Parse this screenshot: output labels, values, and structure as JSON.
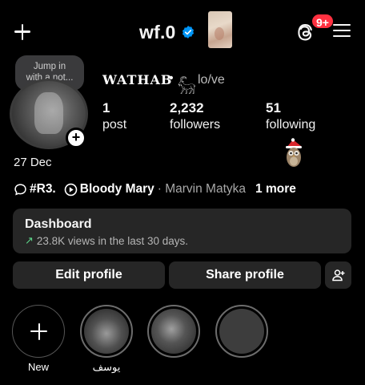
{
  "header": {
    "username": "wf.0",
    "badge_count": "9+",
    "icons": [
      "plus-icon",
      "verified-icon",
      "threads-icon",
      "menu-icon"
    ]
  },
  "note": {
    "text_line1": "Jump in",
    "text_line2": "with a not..."
  },
  "profile": {
    "display_name": "WATHAB",
    "display_sep": "•",
    "display_glyph": "𓃵",
    "display_suffix": "lo/ve",
    "birthday": "27 Dec"
  },
  "stats": [
    {
      "value": "1",
      "label": "post"
    },
    {
      "value": "2,232",
      "label": "followers"
    },
    {
      "value": "51",
      "label": "following"
    }
  ],
  "links": {
    "channel": "#R3.",
    "song": "Bloody Mary",
    "artist": "· Marvin Matyka",
    "more": "1 more"
  },
  "dashboard": {
    "title": "Dashboard",
    "subtitle": "23.8K views in the last 30 days.",
    "arrow": "↗",
    "accent": "#5cd68a"
  },
  "buttons": {
    "edit": "Edit profile",
    "share": "Share profile"
  },
  "highlights": [
    {
      "label": "New"
    },
    {
      "label": "يوسف"
    },
    {
      "label": ""
    },
    {
      "label": ""
    }
  ],
  "colors": {
    "badge": "#ff3040",
    "verified": "#0095f6",
    "surface": "#262626"
  }
}
